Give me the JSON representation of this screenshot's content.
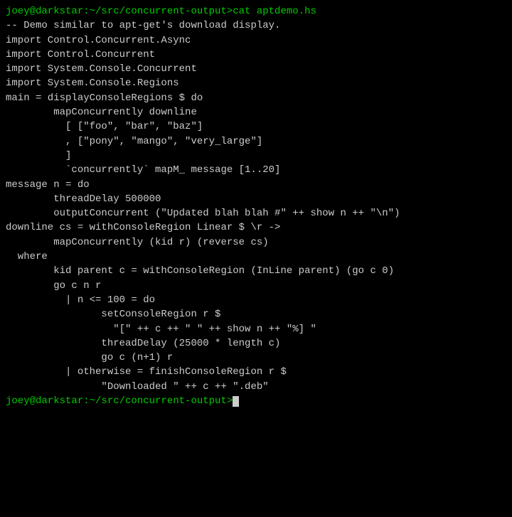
{
  "terminal": {
    "lines": [
      {
        "id": "line-1",
        "segments": [
          {
            "text": "joey@darkstar:~/src/concurrent-output>cat aptdemo.hs",
            "class": "green"
          }
        ]
      },
      {
        "id": "line-2",
        "segments": [
          {
            "text": "-- Demo similar to apt-get's download display.",
            "class": ""
          }
        ]
      },
      {
        "id": "line-3",
        "segments": [
          {
            "text": "",
            "class": ""
          }
        ]
      },
      {
        "id": "line-4",
        "segments": [
          {
            "text": "import Control.Concurrent.Async",
            "class": ""
          }
        ]
      },
      {
        "id": "line-5",
        "segments": [
          {
            "text": "import Control.Concurrent",
            "class": ""
          }
        ]
      },
      {
        "id": "line-6",
        "segments": [
          {
            "text": "import System.Console.Concurrent",
            "class": ""
          }
        ]
      },
      {
        "id": "line-7",
        "segments": [
          {
            "text": "import System.Console.Regions",
            "class": ""
          }
        ]
      },
      {
        "id": "line-8",
        "segments": [
          {
            "text": "",
            "class": ""
          }
        ]
      },
      {
        "id": "line-9",
        "segments": [
          {
            "text": "main = displayConsoleRegions $ do",
            "class": ""
          }
        ]
      },
      {
        "id": "line-10",
        "segments": [
          {
            "text": "        mapConcurrently downline",
            "class": ""
          }
        ]
      },
      {
        "id": "line-11",
        "segments": [
          {
            "text": "          [ [\"foo\", \"bar\", \"baz\"]",
            "class": ""
          }
        ]
      },
      {
        "id": "line-12",
        "segments": [
          {
            "text": "          , [\"pony\", \"mango\", \"very_large\"]",
            "class": ""
          }
        ]
      },
      {
        "id": "line-13",
        "segments": [
          {
            "text": "          ]",
            "class": ""
          }
        ]
      },
      {
        "id": "line-14",
        "segments": [
          {
            "text": "          `concurrently` mapM_ message [1..20]",
            "class": ""
          }
        ]
      },
      {
        "id": "line-15",
        "segments": [
          {
            "text": "",
            "class": ""
          }
        ]
      },
      {
        "id": "line-16",
        "segments": [
          {
            "text": "message n = do",
            "class": ""
          }
        ]
      },
      {
        "id": "line-17",
        "segments": [
          {
            "text": "        threadDelay 500000",
            "class": ""
          }
        ]
      },
      {
        "id": "line-18",
        "segments": [
          {
            "text": "        outputConcurrent (\"Updated blah blah #\" ++ show n ++ \"\\n\")",
            "class": ""
          }
        ]
      },
      {
        "id": "line-19",
        "segments": [
          {
            "text": "",
            "class": ""
          }
        ]
      },
      {
        "id": "line-20",
        "segments": [
          {
            "text": "downline cs = withConsoleRegion Linear $ \\r ->",
            "class": ""
          }
        ]
      },
      {
        "id": "line-21",
        "segments": [
          {
            "text": "        mapConcurrently (kid r) (reverse cs)",
            "class": ""
          }
        ]
      },
      {
        "id": "line-22",
        "segments": [
          {
            "text": "  where",
            "class": ""
          }
        ]
      },
      {
        "id": "line-23",
        "segments": [
          {
            "text": "        kid parent c = withConsoleRegion (InLine parent) (go c 0)",
            "class": ""
          }
        ]
      },
      {
        "id": "line-24",
        "segments": [
          {
            "text": "        go c n r",
            "class": ""
          }
        ]
      },
      {
        "id": "line-25",
        "segments": [
          {
            "text": "          | n <= 100 = do",
            "class": ""
          }
        ]
      },
      {
        "id": "line-26",
        "segments": [
          {
            "text": "                setConsoleRegion r $",
            "class": ""
          }
        ]
      },
      {
        "id": "line-27",
        "segments": [
          {
            "text": "                  \"[\" ++ c ++ \" \" ++ show n ++ \"%] \"",
            "class": ""
          }
        ]
      },
      {
        "id": "line-28",
        "segments": [
          {
            "text": "                threadDelay (25000 * length c)",
            "class": ""
          }
        ]
      },
      {
        "id": "line-29",
        "segments": [
          {
            "text": "                go c (n+1) r",
            "class": ""
          }
        ]
      },
      {
        "id": "line-30",
        "segments": [
          {
            "text": "          | otherwise = finishConsoleRegion r $",
            "class": ""
          }
        ]
      },
      {
        "id": "line-31",
        "segments": [
          {
            "text": "                \"Downloaded \" ++ c ++ \".deb\"",
            "class": ""
          }
        ]
      },
      {
        "id": "line-32",
        "segments": [
          {
            "text": "joey@darkstar:~/src/concurrent-output>",
            "class": "green",
            "cursor": true
          }
        ]
      }
    ]
  }
}
